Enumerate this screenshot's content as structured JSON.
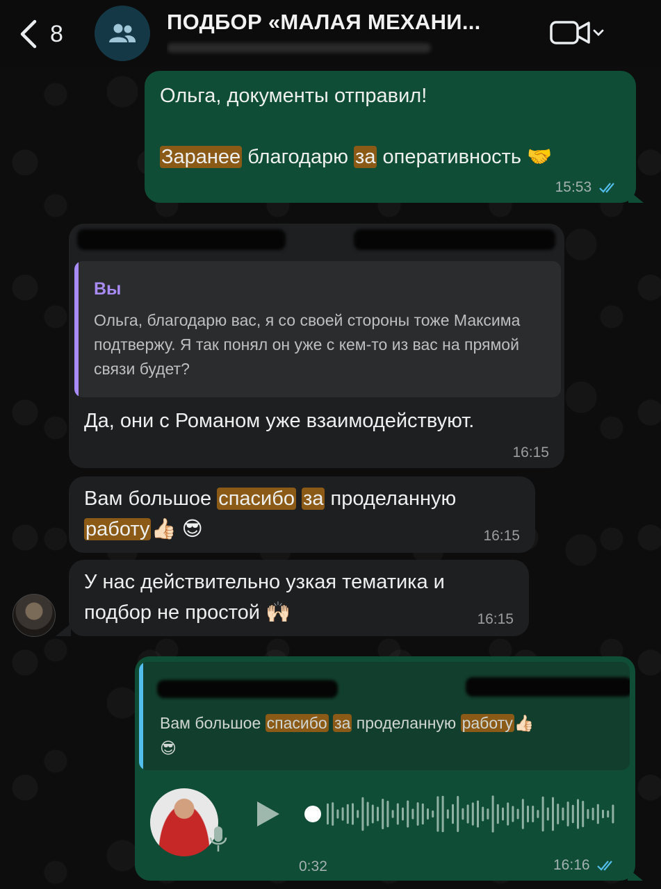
{
  "header": {
    "back_count": "8",
    "title": "ПОДБОР «МАЛАЯ МЕХАНИ...",
    "icons": [
      "chevron-left-icon",
      "group-icon",
      "video-call-icon",
      "chevron-down-icon"
    ]
  },
  "colors": {
    "outgoing_bubble": "#0f4d36",
    "incoming_bubble": "#1e1f21",
    "highlight": "#8a5a16",
    "read_ticks": "#53bdeb",
    "quote_you": "#a98bf5",
    "quote_reply": "#53bdeb"
  },
  "messages": {
    "m1": {
      "line1": "Ольга, документы отправил!",
      "w1": "Заранее",
      "w2": " благодарю ",
      "w3": "за",
      "w4": " оперативность 🤝",
      "time": "15:53"
    },
    "m2": {
      "quote_author": "Вы",
      "quote_text": "Ольга, благодарю вас, я со своей стороны тоже Максима подтвержу. Я так понял он уже с кем-то из вас на прямой связи будет?",
      "text": "Да, они с Романом уже взаимодействуют.",
      "time": "16:15"
    },
    "m3": {
      "w1": "Вам большое ",
      "w2": "спасибо",
      "w3": "за",
      "w4": " проделанную",
      "w5": "работу",
      "w6": "👍🏻 😎",
      "time": "16:15"
    },
    "m4": {
      "text": "У нас действительно узкая тематика и подбор не простой 🙌🏻",
      "time": "16:15"
    },
    "m5": {
      "q1": "Вам большое ",
      "q2": "спасибо",
      "q3": "за",
      "q4": " проделанную ",
      "q5": "работу",
      "q6": "👍🏻",
      "q7": "😎",
      "voice_duration": "0:32",
      "time": "16:16"
    }
  }
}
